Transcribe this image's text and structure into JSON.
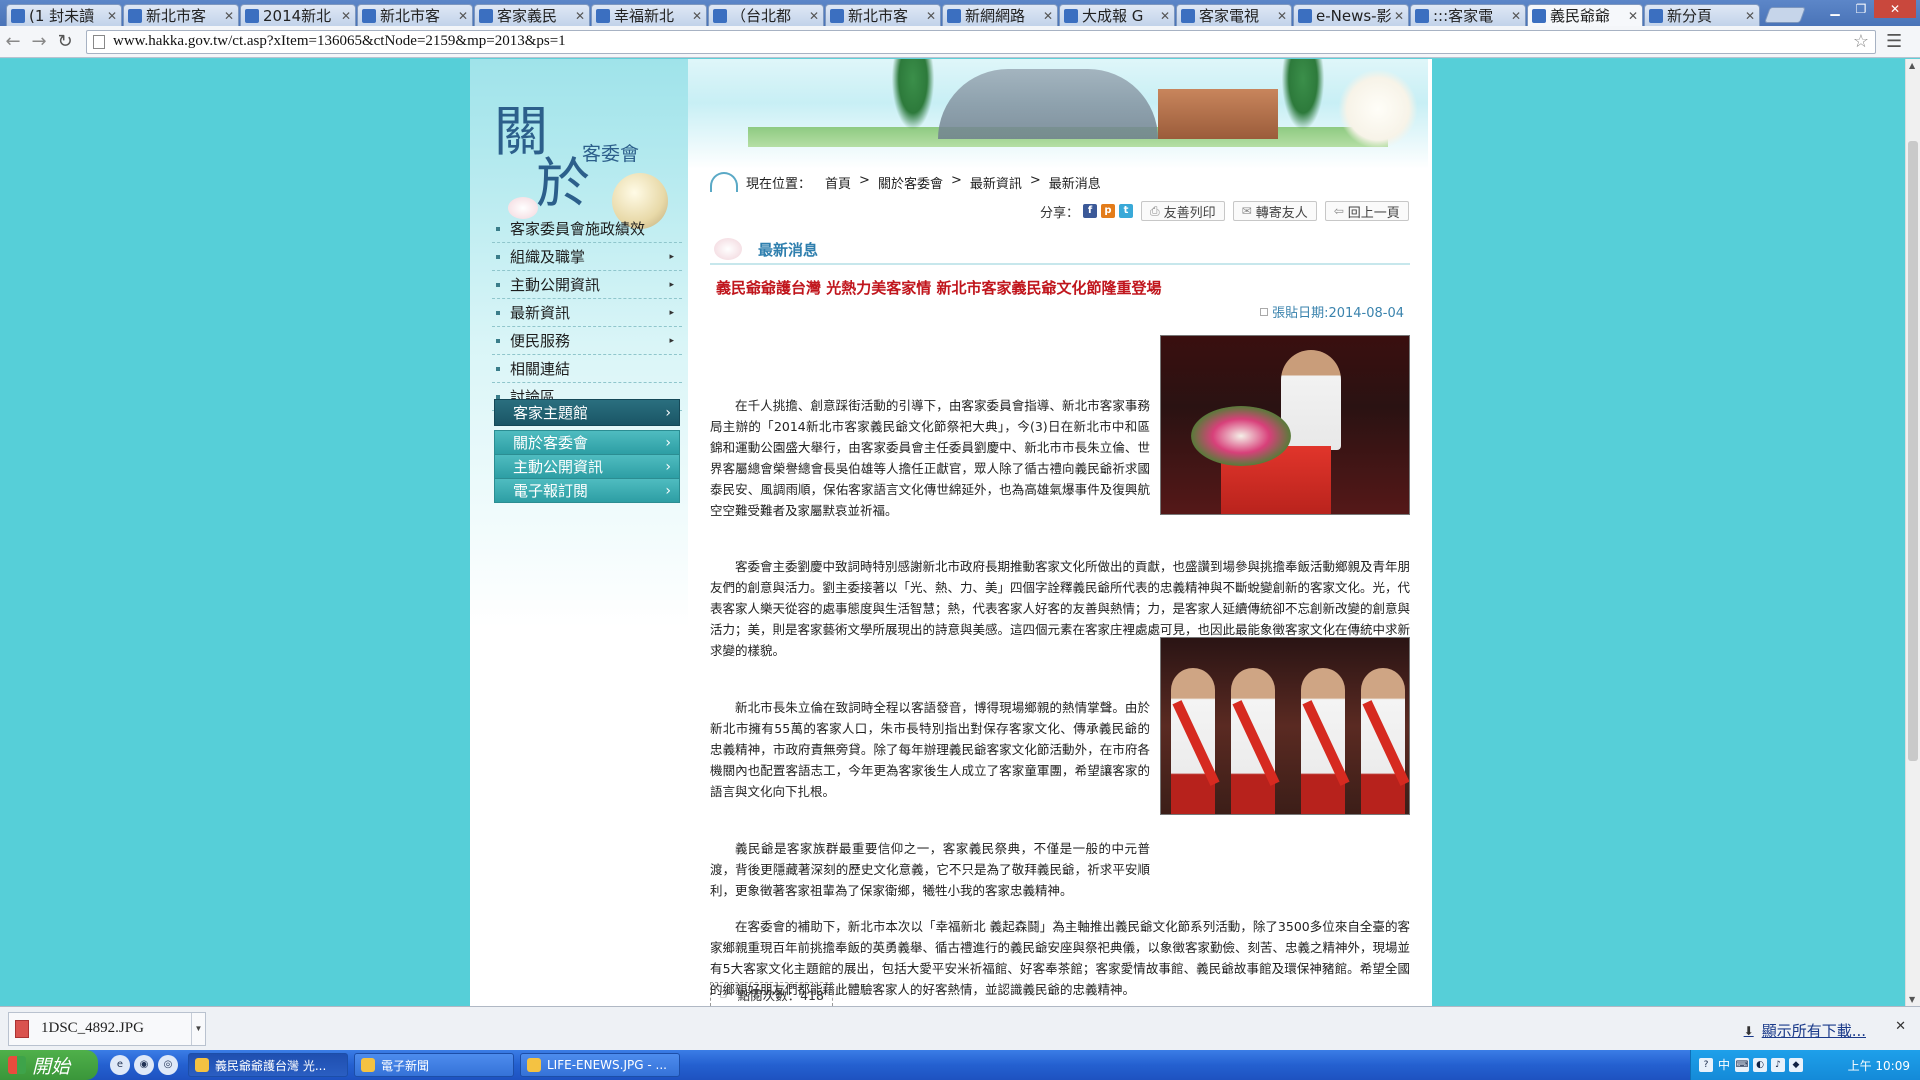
{
  "browser": {
    "tabs": [
      {
        "title": "(1 封未讀",
        "icon": "mail-icon",
        "active": false
      },
      {
        "title": "新北市客",
        "icon": "page-icon",
        "active": false
      },
      {
        "title": "2014新北",
        "icon": "yahoo-icon",
        "active": false
      },
      {
        "title": "新北市客",
        "icon": "page-icon",
        "active": false
      },
      {
        "title": "客家義民",
        "icon": "page-icon",
        "active": false
      },
      {
        "title": "幸福新北",
        "icon": "page-icon",
        "active": false
      },
      {
        "title": "（台北都",
        "icon": "ltn-icon",
        "active": false
      },
      {
        "title": "新北市客",
        "icon": "page-icon",
        "active": false
      },
      {
        "title": "新網網路",
        "icon": "page-icon",
        "active": false
      },
      {
        "title": "大成報 G",
        "icon": "page-icon",
        "active": false
      },
      {
        "title": "客家電視",
        "icon": "page-icon",
        "active": false
      },
      {
        "title": "e-News-影",
        "icon": "page-icon",
        "active": false
      },
      {
        "title": ":::客家電",
        "icon": "page-icon",
        "active": false
      },
      {
        "title": "義民爺爺",
        "icon": "page-icon",
        "active": true
      },
      {
        "title": "新分頁",
        "icon": "page-icon",
        "active": false
      }
    ],
    "url": "www.hakka.gov.tw/ct.asp?xItem=136065&ctNode=2159&mp=2013&ps=1"
  },
  "site": {
    "brand_big": "關",
    "brand_big2": "於",
    "brand_sub": "客委會",
    "menu": [
      {
        "label": "客家委員會施政績效",
        "arrow": ""
      },
      {
        "label": "組織及職掌",
        "arrow": "▸"
      },
      {
        "label": "主動公開資訊",
        "arrow": "▸"
      },
      {
        "label": "最新資訊",
        "arrow": "▸"
      },
      {
        "label": "便民服務",
        "arrow": "▸"
      },
      {
        "label": "相關連結",
        "arrow": ""
      },
      {
        "label": "討論區",
        "arrow": ""
      }
    ],
    "buttons": {
      "theme": "客家主題館",
      "about": "關於客委會",
      "public_info": "主動公開資訊",
      "newsletter": "電子報訂閱"
    }
  },
  "breadcrumb": {
    "prefix": "現在位置：",
    "items": [
      "首頁",
      "關於客委會",
      "最新資訊",
      "最新消息"
    ],
    "separator": ">"
  },
  "share": {
    "label": "分享：",
    "print": "友善列印",
    "forward": "轉寄友人",
    "back": "回上一頁"
  },
  "section_title": "最新消息",
  "article": {
    "title": "義民爺爺護台灣 光熱力美客家情 新北市客家義民爺文化節隆重登場",
    "date": "張貼日期:2014-08-04",
    "paragraphs": [
      "在千人挑擔、創意踩街活動的引導下，由客家委員會指導、新北市客家事務局主辦的「2014新北市客家義民爺文化節祭祀大典」，今(3)日在新北市中和區錦和運動公園盛大舉行，由客家委員會主任委員劉慶中、新北市市長朱立倫、世界客屬總會榮譽總會長吳伯雄等人擔任正獻官，眾人除了循古禮向義民爺祈求國泰民安、風調雨順，保佑客家語言文化傳世綿延外，也為高雄氣爆事件及復興航空空難受難者及家屬默哀並祈福。",
      "客委會主委劉慶中致詞時特別感謝新北市政府長期推動客家文化所做出的貢獻，也盛讚到場參與挑擔奉飯活動鄉親及青年朋友們的創意與活力。劉主委接著以「光、熱、力、美」四個字詮釋義民爺所代表的忠義精神與不斷蛻變創新的客家文化。光，代表客家人樂天從容的處事態度與生活智慧；熱，代表客家人好客的友善與熱情；力，是客家人延續傳統卻不忘創新改變的創意與活力；美，則是客家藝術文學所展現出的詩意與美感。這四個元素在客家庄裡處處可見，也因此最能象徵客家文化在傳統中求新求變的樣貌。",
      "新北市長朱立倫在致詞時全程以客語發音，博得現場鄉親的熱情掌聲。由於新北市擁有55萬的客家人口，朱市長特別指出對保存客家文化、傳承義民爺的忠義精神，市政府責無旁貸。除了每年辦理義民爺客家文化節活動外，在市府各機關內也配置客語志工，今年更為客家後生人成立了客家童軍團，希望讓客家的語言與文化向下扎根。",
      "義民爺是客家族群最重要信仰之一，客家義民祭典，不僅是一般的中元普渡，背後更隱藏著深刻的歷史文化意義，它不只是為了敬拜義民爺，祈求平安順利，更象徵著客家祖輩為了保家衛鄉，犧牲小我的客家忠義精神。",
      "在客委會的補助下，新北市本次以「幸福新北 義起森鬪」為主軸推出義民爺文化節系列活動，除了3500多位來自全臺的客家鄉親重現百年前挑擔奉飯的英勇義舉、循古禮進行的義民爺安座與祭祀典儀，以象徵客家勤儉、刻苦、忠義之精神外，現場並有5大客家文化主題館的展出，包括大愛平安米祈福館、好客奉茶館；客家愛情故事館、義民爺故事館及環保神豬館。希望全國的鄉親好朋友們都能藉此體驗客家人的好客熱情，並認識義民爺的忠義精神。"
    ],
    "view_count": "點閱次數：418"
  },
  "download": {
    "filename": "1DSC_4892.JPG",
    "show_all": "顯示所有下載..."
  },
  "taskbar": {
    "start": "開始",
    "windows": [
      {
        "title": "義民爺爺護台灣 光...",
        "active": true
      },
      {
        "title": "電子新聞",
        "active": false
      },
      {
        "title": "LIFE-ENEWS.JPG - ...",
        "active": false
      }
    ],
    "clock": "上午 10:09",
    "ime": "中"
  }
}
